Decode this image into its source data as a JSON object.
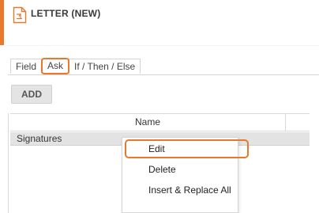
{
  "header": {
    "title": "LETTER (NEW)",
    "icon": "document-icon",
    "accent_color": "#e8782c"
  },
  "tabs": [
    {
      "label": "Field",
      "active": false
    },
    {
      "label": "Ask",
      "active": true
    },
    {
      "label": "If / Then / Else",
      "active": false
    }
  ],
  "toolbar": {
    "add_label": "ADD"
  },
  "grid": {
    "columns": [
      "Name"
    ],
    "rows": [
      {
        "name": "Signatures",
        "selected": true
      }
    ]
  },
  "context_menu": {
    "items": [
      {
        "label": "Edit",
        "highlighted": true
      },
      {
        "label": "Delete",
        "highlighted": false
      },
      {
        "label": "Insert & Replace All",
        "highlighted": false
      }
    ]
  }
}
